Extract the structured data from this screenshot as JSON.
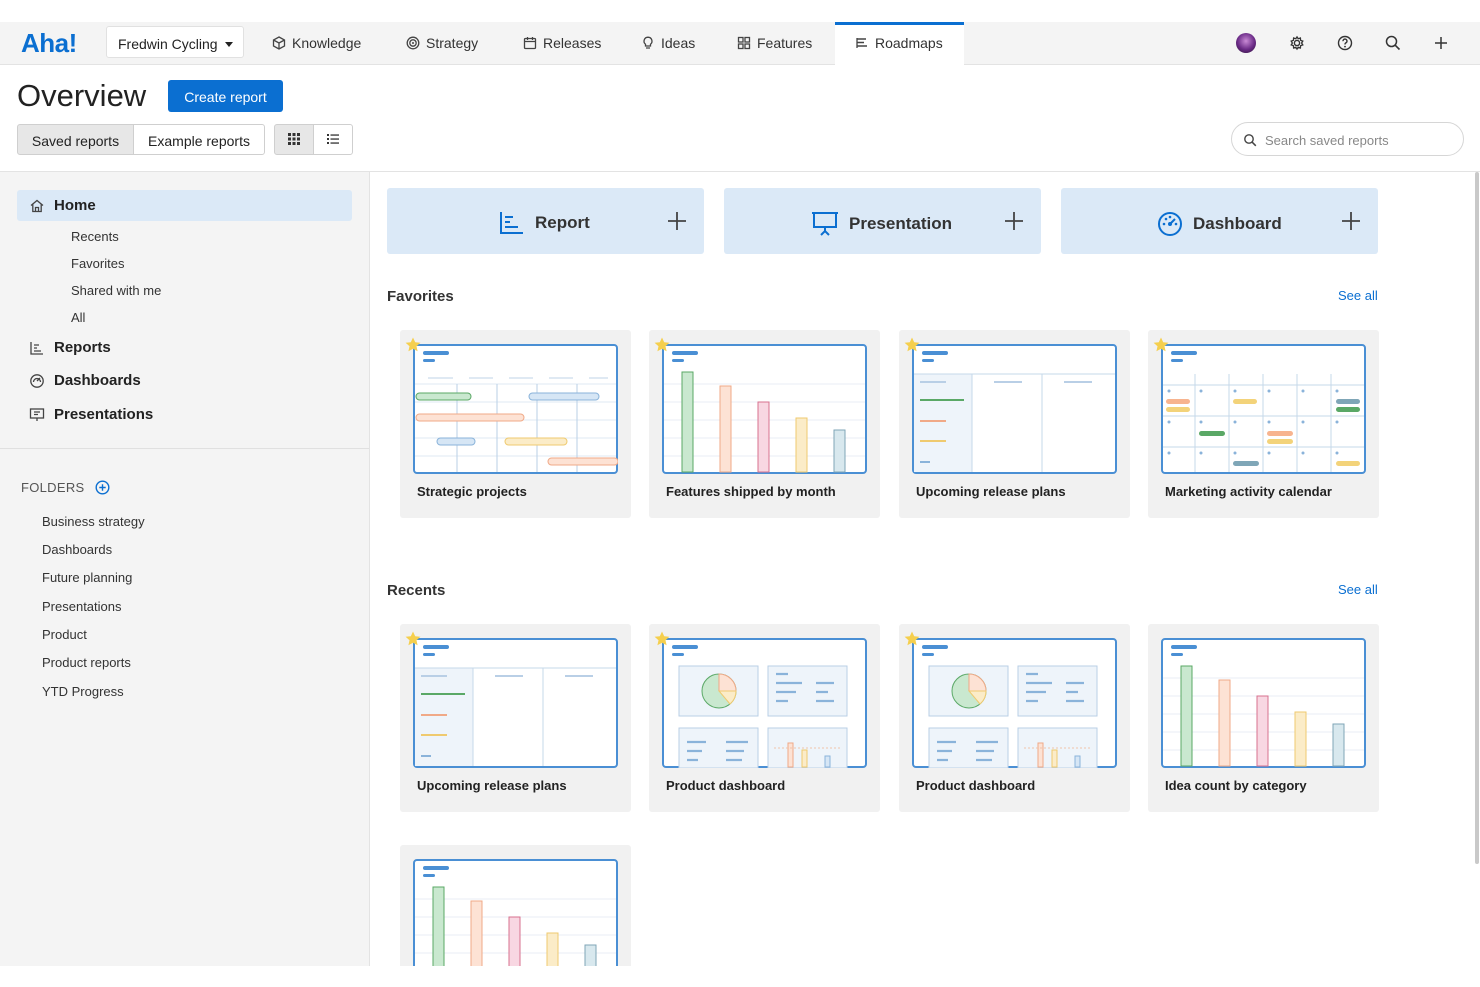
{
  "app": {
    "logo": "Aha!",
    "workspace": "Fredwin Cycling"
  },
  "nav": {
    "items": [
      {
        "label": "Knowledge",
        "icon": "cube-icon"
      },
      {
        "label": "Strategy",
        "icon": "target-icon"
      },
      {
        "label": "Releases",
        "icon": "calendar-icon"
      },
      {
        "label": "Ideas",
        "icon": "lightbulb-icon"
      },
      {
        "label": "Features",
        "icon": "grid-icon"
      },
      {
        "label": "Roadmaps",
        "icon": "roadmap-icon",
        "active": true
      }
    ]
  },
  "header": {
    "title": "Overview",
    "create_label": "Create report",
    "tabs": [
      {
        "label": "Saved reports",
        "active": true
      },
      {
        "label": "Example reports"
      }
    ],
    "search_placeholder": "Search saved reports"
  },
  "sidebar": {
    "home": "Home",
    "home_sub": [
      "Recents",
      "Favorites",
      "Shared with me",
      "All"
    ],
    "main": [
      "Reports",
      "Dashboards",
      "Presentations"
    ],
    "folders_title": "FOLDERS",
    "folders": [
      "Business strategy",
      "Dashboards",
      "Future planning",
      "Presentations",
      "Product",
      "Product reports",
      "YTD Progress"
    ]
  },
  "create_cards": [
    "Report",
    "Presentation",
    "Dashboard"
  ],
  "favorites": {
    "title": "Favorites",
    "see_all": "See all",
    "cards": [
      {
        "name": "Strategic projects",
        "thumb": "gantt",
        "starred": true
      },
      {
        "name": "Features shipped by month",
        "thumb": "bars",
        "starred": true
      },
      {
        "name": "Upcoming release plans",
        "thumb": "table",
        "starred": true
      },
      {
        "name": "Marketing activity calendar",
        "thumb": "calendar",
        "starred": true
      }
    ]
  },
  "recents": {
    "title": "Recents",
    "see_all": "See all",
    "cards": [
      {
        "name": "Upcoming release plans",
        "thumb": "table",
        "starred": true
      },
      {
        "name": "Product dashboard",
        "thumb": "dashboard",
        "starred": true
      },
      {
        "name": "Product dashboard",
        "thumb": "dashboard",
        "starred": true
      },
      {
        "name": "Idea count by category",
        "thumb": "bars",
        "starred": false
      },
      {
        "name": "",
        "thumb": "bars",
        "starred": false
      }
    ]
  },
  "colors": {
    "accent": "#0b6fd1",
    "highlight": "#dbe9f7",
    "frame": "#4a8fd4"
  }
}
